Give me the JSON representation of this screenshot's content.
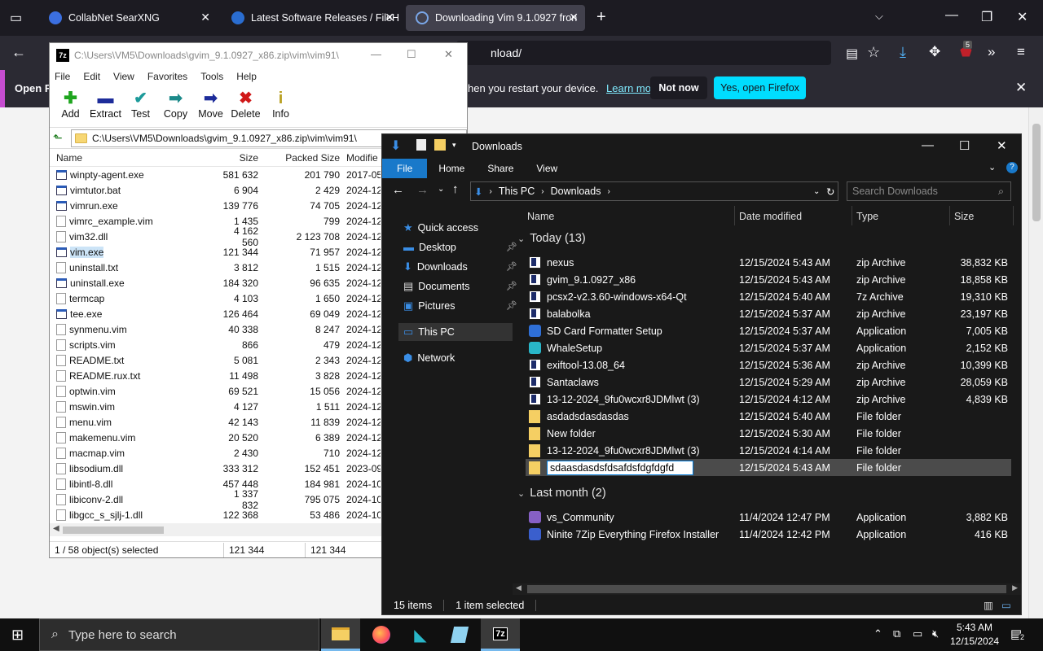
{
  "firefox": {
    "tabs": [
      {
        "label": "CollabNet SearXNG",
        "icon_color": "#3b6fe0"
      },
      {
        "label": "Latest Software Releases / FileH",
        "icon_color": "#2a6dd0"
      },
      {
        "label": "Downloading Vim 9.1.0927 fron",
        "icon_color": "#2a6dd0"
      }
    ],
    "url_tail": "nload/",
    "badge_count": "5",
    "notification": {
      "prefix": "Open Fi",
      "text": "hen you restart your device.",
      "link": "Learn more",
      "not_now": "Not now",
      "yes": "Yes, open Firefox"
    }
  },
  "sevenzip": {
    "title": "C:\\Users\\VM5\\Downloads\\gvim_9.1.0927_x86.zip\\vim\\vim91\\",
    "menu": [
      "File",
      "Edit",
      "View",
      "Favorites",
      "Tools",
      "Help"
    ],
    "tools": [
      {
        "label": "Add",
        "icon": "plus-icon",
        "glyph": "✚",
        "color": "#1fa51f"
      },
      {
        "label": "Extract",
        "icon": "minus-icon",
        "glyph": "▬",
        "color": "#1d2c9a"
      },
      {
        "label": "Test",
        "icon": "check-icon",
        "glyph": "✔",
        "color": "#1c9a9a"
      },
      {
        "label": "Copy",
        "icon": "copy-arrow-icon",
        "glyph": "➡",
        "color": "#1c8a8a"
      },
      {
        "label": "Move",
        "icon": "move-arrow-icon",
        "glyph": "➡",
        "color": "#1d2c9a"
      },
      {
        "label": "Delete",
        "icon": "delete-x-icon",
        "glyph": "✖",
        "color": "#d01818"
      },
      {
        "label": "Info",
        "icon": "info-icon",
        "glyph": "i",
        "color": "#b8a020"
      }
    ],
    "path": "C:\\Users\\VM5\\Downloads\\gvim_9.1.0927_x86.zip\\vim\\vim91\\",
    "columns": {
      "name": "Name",
      "size": "Size",
      "packed": "Packed Size",
      "modified": "Modifie"
    },
    "files": [
      {
        "name": "winpty-agent.exe",
        "size": "581 632",
        "packed": "201 790",
        "modified": "2017-05",
        "kind": "exe"
      },
      {
        "name": "vimtutor.bat",
        "size": "6 904",
        "packed": "2 429",
        "modified": "2024-12",
        "kind": "exe"
      },
      {
        "name": "vimrun.exe",
        "size": "139 776",
        "packed": "74 705",
        "modified": "2024-12",
        "kind": "exe"
      },
      {
        "name": "vimrc_example.vim",
        "size": "1 435",
        "packed": "799",
        "modified": "2024-12",
        "kind": "file"
      },
      {
        "name": "vim32.dll",
        "size": "4 162 560",
        "packed": "2 123 708",
        "modified": "2024-12",
        "kind": "file"
      },
      {
        "name": "vim.exe",
        "size": "121 344",
        "packed": "71 957",
        "modified": "2024-12",
        "kind": "exe",
        "selected": true
      },
      {
        "name": "uninstall.txt",
        "size": "3 812",
        "packed": "1 515",
        "modified": "2024-12",
        "kind": "file"
      },
      {
        "name": "uninstall.exe",
        "size": "184 320",
        "packed": "96 635",
        "modified": "2024-12",
        "kind": "exe"
      },
      {
        "name": "termcap",
        "size": "4 103",
        "packed": "1 650",
        "modified": "2024-12",
        "kind": "file"
      },
      {
        "name": "tee.exe",
        "size": "126 464",
        "packed": "69 049",
        "modified": "2024-12",
        "kind": "exe"
      },
      {
        "name": "synmenu.vim",
        "size": "40 338",
        "packed": "8 247",
        "modified": "2024-12",
        "kind": "file"
      },
      {
        "name": "scripts.vim",
        "size": "866",
        "packed": "479",
        "modified": "2024-12",
        "kind": "file"
      },
      {
        "name": "README.txt",
        "size": "5 081",
        "packed": "2 343",
        "modified": "2024-12",
        "kind": "file"
      },
      {
        "name": "README.rux.txt",
        "size": "11 498",
        "packed": "3 828",
        "modified": "2024-12",
        "kind": "file"
      },
      {
        "name": "optwin.vim",
        "size": "69 521",
        "packed": "15 056",
        "modified": "2024-12",
        "kind": "file"
      },
      {
        "name": "mswin.vim",
        "size": "4 127",
        "packed": "1 511",
        "modified": "2024-12",
        "kind": "file"
      },
      {
        "name": "menu.vim",
        "size": "42 143",
        "packed": "11 839",
        "modified": "2024-12",
        "kind": "file"
      },
      {
        "name": "makemenu.vim",
        "size": "20 520",
        "packed": "6 389",
        "modified": "2024-12",
        "kind": "file"
      },
      {
        "name": "macmap.vim",
        "size": "2 430",
        "packed": "710",
        "modified": "2024-12",
        "kind": "file"
      },
      {
        "name": "libsodium.dll",
        "size": "333 312",
        "packed": "152 451",
        "modified": "2023-09",
        "kind": "file"
      },
      {
        "name": "libintl-8.dll",
        "size": "457 448",
        "packed": "184 981",
        "modified": "2024-10",
        "kind": "file"
      },
      {
        "name": "libiconv-2.dll",
        "size": "1 337 832",
        "packed": "795 075",
        "modified": "2024-10",
        "kind": "file"
      },
      {
        "name": "libgcc_s_sjlj-1.dll",
        "size": "122 368",
        "packed": "53 486",
        "modified": "2024-10",
        "kind": "file"
      }
    ],
    "status": {
      "selection": "1 / 58 object(s) selected",
      "size": "121 344",
      "packed": "121 344"
    }
  },
  "explorer": {
    "title": "Downloads",
    "ribbon": [
      "File",
      "Home",
      "Share",
      "View"
    ],
    "breadcrumb": [
      "This PC",
      "Downloads"
    ],
    "search_placeholder": "Search Downloads",
    "nav": [
      {
        "label": "Quick access",
        "icon": "star-icon",
        "color": "#3a8ee6"
      },
      {
        "label": "Desktop",
        "icon": "desktop-icon",
        "color": "#3a8ee6",
        "pinned": true
      },
      {
        "label": "Downloads",
        "icon": "download-icon",
        "color": "#3a8ee6",
        "pinned": true
      },
      {
        "label": "Documents",
        "icon": "documents-icon",
        "color": "#dcdcdc",
        "pinned": true
      },
      {
        "label": "Pictures",
        "icon": "pictures-icon",
        "color": "#3a8ee6",
        "pinned": true
      },
      {
        "label": "This PC",
        "icon": "computer-icon",
        "color": "#3a8ee6"
      },
      {
        "label": "Network",
        "icon": "network-icon",
        "color": "#3a8ee6"
      }
    ],
    "columns": {
      "name": "Name",
      "date": "Date modified",
      "type": "Type",
      "size": "Size"
    },
    "groups": [
      {
        "title": "Today (13)",
        "items": [
          {
            "name": "nexus",
            "date": "12/15/2024 5:43 AM",
            "type": "zip Archive",
            "size": "38,832 KB",
            "icon": "zip"
          },
          {
            "name": "gvim_9.1.0927_x86",
            "date": "12/15/2024 5:43 AM",
            "type": "zip Archive",
            "size": "18,858 KB",
            "icon": "zip"
          },
          {
            "name": "pcsx2-v2.3.60-windows-x64-Qt",
            "date": "12/15/2024 5:40 AM",
            "type": "7z Archive",
            "size": "19,310 KB",
            "icon": "zip"
          },
          {
            "name": "balabolka",
            "date": "12/15/2024 5:37 AM",
            "type": "zip Archive",
            "size": "23,197 KB",
            "icon": "zip"
          },
          {
            "name": "SD Card Formatter Setup",
            "date": "12/15/2024 5:37 AM",
            "type": "Application",
            "size": "7,005 KB",
            "icon": "app",
            "color": "#2f6fd6"
          },
          {
            "name": "WhaleSetup",
            "date": "12/15/2024 5:37 AM",
            "type": "Application",
            "size": "2,152 KB",
            "icon": "app",
            "color": "#29b6c8"
          },
          {
            "name": "exiftool-13.08_64",
            "date": "12/15/2024 5:36 AM",
            "type": "zip Archive",
            "size": "10,399 KB",
            "icon": "zip"
          },
          {
            "name": "Santaclaws",
            "date": "12/15/2024 5:29 AM",
            "type": "zip Archive",
            "size": "28,059 KB",
            "icon": "zip"
          },
          {
            "name": "13-12-2024_9fu0wcxr8JDMlwt (3)",
            "date": "12/15/2024 4:12 AM",
            "type": "zip Archive",
            "size": "4,839 KB",
            "icon": "zip"
          },
          {
            "name": "asdadsdasdasdas",
            "date": "12/15/2024 5:40 AM",
            "type": "File folder",
            "size": "",
            "icon": "folder"
          },
          {
            "name": "New folder",
            "date": "12/15/2024 5:30 AM",
            "type": "File folder",
            "size": "",
            "icon": "folder"
          },
          {
            "name": "13-12-2024_9fu0wcxr8JDMlwt (3)",
            "date": "12/15/2024 4:14 AM",
            "type": "File folder",
            "size": "",
            "icon": "folder"
          },
          {
            "name": "sdaasdasdsfdsafdsfdgfdgfd",
            "date": "12/15/2024 5:43 AM",
            "type": "File folder",
            "size": "",
            "icon": "folder",
            "renaming": true
          }
        ]
      },
      {
        "title": "Last month (2)",
        "items": [
          {
            "name": "vs_Community",
            "date": "11/4/2024 12:47 PM",
            "type": "Application",
            "size": "3,882 KB",
            "icon": "app",
            "color": "#8660c5"
          },
          {
            "name": "Ninite 7Zip Everything Firefox Installer",
            "date": "11/4/2024 12:42 PM",
            "type": "Application",
            "size": "416 KB",
            "icon": "app",
            "color": "#3a5fcd"
          }
        ]
      }
    ],
    "status": {
      "count": "15 items",
      "selected": "1 item selected"
    }
  },
  "taskbar": {
    "search_placeholder": "Type here to search",
    "time": "5:43 AM",
    "date": "12/15/2024",
    "notification_count": "2"
  }
}
